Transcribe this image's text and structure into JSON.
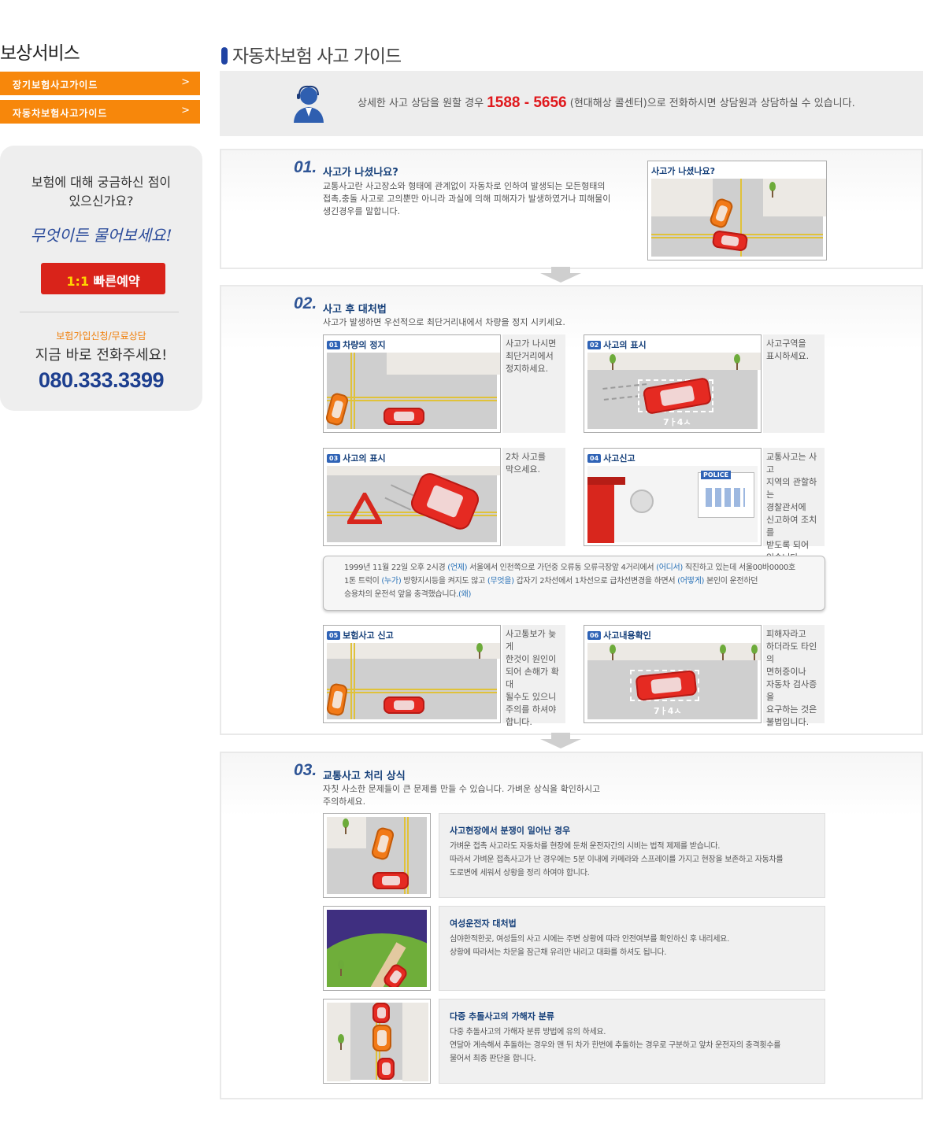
{
  "sidebar": {
    "title": "보상서비스",
    "menu": [
      {
        "label": "장기보험사고가이드",
        "chevron": ">"
      },
      {
        "label": "자동차보험사고가이드",
        "chevron": ">"
      }
    ],
    "question": {
      "line1": "보험에 대해 궁금하신 점이",
      "line2": "있으신가요?",
      "handwriting": "무엇이든 물어보세요!",
      "reserve_ratio": "1:1",
      "reserve_label": "빠른예약",
      "consult_label": "보험가입신청/무료상담",
      "call_label": "지금 바로 전화주세요!",
      "phone": "080.333.3399"
    }
  },
  "page_title": "자동차보험 사고 가이드",
  "contact": {
    "before": "상세한 사고 상담을 원할 경우 ",
    "number": "1588 - 5656",
    "after": " (현대해상 콜센터)으로 전화하시면 상담원과 상담하실 수 있습니다."
  },
  "section1": {
    "num": "01.",
    "title": "사고가 나셨나요?",
    "desc_lines": [
      "교통사고란 사고장소와 형태에 관계없이 자동차로 인하여 발생되는 모든형태의",
      "접촉,충돌 사고로 고의뿐만 아니라 과실에 의해 피해자가 발생하였거나 피해물이",
      "생긴경우를 말합니다."
    ],
    "image_label": "사고가 나셨나요?"
  },
  "section2": {
    "num": "02.",
    "title": "사고 후 대처법",
    "desc": "사고가 발생하면 우선적으로 최단거리내에서 차량을 정지 시키세요.",
    "steps": [
      {
        "badge": "01",
        "label": "차량의 정지",
        "text": [
          "사고가 나시면",
          "최단거리에서",
          "정지하세요."
        ]
      },
      {
        "badge": "02",
        "label": "사고의 표시",
        "text": [
          "사고구역을",
          "표시하세요."
        ],
        "plate": "7ㅏ4ㅅ"
      },
      {
        "badge": "03",
        "label": "사고의 표시",
        "text": [
          "2차 사고를",
          "막으세요."
        ]
      },
      {
        "badge": "04",
        "label": "사고신고",
        "text": [
          "교통사고는 사고",
          "지역의 관할하는",
          "경찰관서에",
          "신고하여 조치를",
          "받도록 되어",
          "있습니다."
        ],
        "police": "POLICE"
      },
      {
        "badge": "05",
        "label": "보험사고 신고",
        "text": [
          "사고통보가 늦게",
          "한것이 원인이",
          "되어 손해가 확대",
          "될수도 있으니",
          "주의를 하셔야",
          "합니다."
        ]
      },
      {
        "badge": "06",
        "label": "사고내용확인",
        "text": [
          "피해자라고",
          "하더라도 타인의",
          "면허증이나",
          "자동차 검사증을",
          "요구하는 것은",
          "불법입니다."
        ],
        "plate": "7ㅏ4ㅅ"
      }
    ],
    "callout": {
      "l1a": "1999년 11월 22일 오후 2시경 ",
      "k1": "(언제)",
      "l1b": " 서울에서 인천쪽으로 가던중 오류동 오류극장앞 4거리에서 ",
      "k2": "(어디서)",
      "l1c": " 직진하고 있는데 서울00바0000호",
      "l2a": "1톤 트럭이 ",
      "k3": "(누가)",
      "l2b": " 방향지시등을 켜지도 않고 ",
      "k4": "(무엇을)",
      "l2c": " 갑자기 2차선에서 1차선으로 급차선변경을 하면서 ",
      "k5": "(어떻게)",
      "l2d": " 본인이 운전하던",
      "l3a": "승용차의 운전석 앞을 충격했습니다.",
      "k6": "(왜)"
    }
  },
  "section3": {
    "num": "03.",
    "title": "교통사고 처리 상식",
    "desc_lines": [
      "자칫 사소한 문제들이 큰 문제를 만들 수 있습니다. 가벼운 상식을 확인하시고",
      "주의하세요."
    ],
    "tips": [
      {
        "title": "사고현장에서 분쟁이 일어난 경우",
        "lines": [
          "가벼운 접촉 사고라도 자동차를 현장에 둔채 운전자간의 시비는 법적 제제를 받습니다.",
          "따라서 가벼운 접촉사고가 난 경우에는 5분 이내에 카메라와 스프레이를 가지고 현장을 보존하고 자동차를",
          "도로변에 세워서 상황을 정리 하여야 합니다."
        ]
      },
      {
        "title": "여성운전자 대처법",
        "lines": [
          "심야한적한곳, 여성들의 사고 시에는 주변 상황에 따라 안전여부를 확인하신 후 내리세요.",
          "상황에 따라서는 차문을 잠근채 유리만 내리고 대화를 하셔도 됩니다."
        ]
      },
      {
        "title": "다중 추돌사고의 가해자 분류",
        "lines": [
          "다중 추돌사고의 가해자 분류 방법에 유의 하세요.",
          "연달아 계속해서 추돌하는 경우와 맨 뒤 차가 한번에 추돌하는 경우로 구분하고 앞차 운전자의 충격횟수를",
          "물어서 최종 판단을 합니다."
        ]
      }
    ]
  },
  "colors": {
    "accent_orange": "#f7870b",
    "brand_blue": "#1f43a3",
    "alert_red": "#e0181c"
  }
}
